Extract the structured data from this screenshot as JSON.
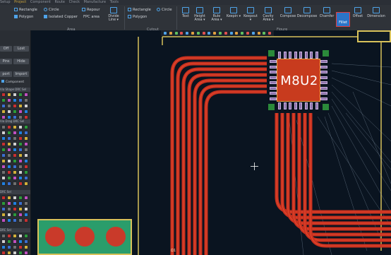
{
  "menubar": {
    "items": [
      "Setup",
      "Project",
      "Component",
      "Route",
      "Check",
      "Manufacture",
      "Tools"
    ],
    "active": "Project"
  },
  "ribbon": {
    "area_group": {
      "label": "Area",
      "items": [
        "Rectangle",
        "Polygon",
        "Circle",
        "Isolated Copper",
        "Repour",
        "FPC area",
        "Divide Line"
      ]
    },
    "cutout_group": {
      "label": "Cutout",
      "items": [
        "Rectangle",
        "Circle",
        "Polygon"
      ]
    },
    "figure_group": {
      "label": "Figure",
      "items": [
        "Text",
        "Height Area",
        "Rule Area",
        "Keepin",
        "Keepout",
        "Cavity Area",
        "Compose",
        "Decompose",
        "Chamfer",
        "Fillet",
        "Offset",
        "Dimension"
      ],
      "selected": "Fillet"
    }
  },
  "panel": {
    "buttons": [
      "Off",
      "Lost",
      "Pins",
      "Hide",
      "port",
      "Import"
    ],
    "component_label": "Component",
    "headers": [
      "Via Shape DRC Sel",
      "Via Drag DRC Sel",
      "DRC Sel",
      "DRC Sel"
    ]
  },
  "board": {
    "component_label": "M8U2",
    "bottom_label": "Ω1"
  },
  "colors": {
    "trace": "#c9311f",
    "trace_edge": "#f05a3a",
    "copper_fill": "#2a9d6b",
    "outline": "#d8c25a",
    "accent": "#4fa3e8",
    "selected_border": "#e43c3c"
  },
  "icons": [
    "rectangle-icon",
    "circle-icon",
    "polygon-icon",
    "repour-icon",
    "crosshair-cursor-icon"
  ]
}
